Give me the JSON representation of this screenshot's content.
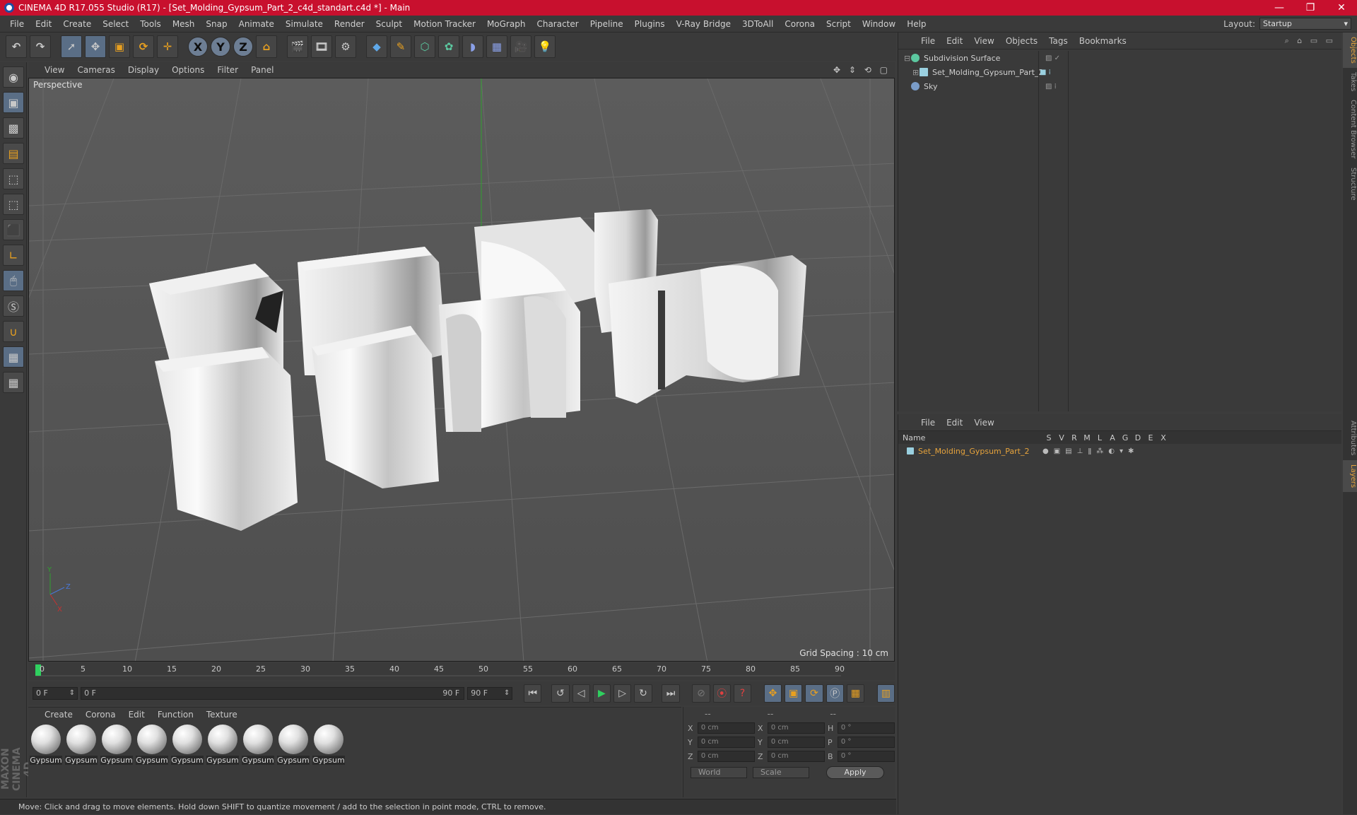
{
  "app": {
    "title": "CINEMA 4D R17.055 Studio (R17) - [Set_Molding_Gypsum_Part_2_c4d_standart.c4d *] - Main",
    "window_controls": [
      "—",
      "❐",
      "✕"
    ]
  },
  "menubar": {
    "items": [
      "File",
      "Edit",
      "Create",
      "Select",
      "Tools",
      "Mesh",
      "Snap",
      "Animate",
      "Simulate",
      "Render",
      "Sculpt",
      "Motion Tracker",
      "MoGraph",
      "Character",
      "Pipeline",
      "Plugins",
      "V-Ray Bridge",
      "3DToAll",
      "Corona",
      "Script",
      "Window",
      "Help"
    ],
    "layout_label": "Layout:",
    "layout_value": "Startup"
  },
  "toolbar": {
    "axis_x": "X",
    "axis_y": "Y",
    "axis_z": "Z"
  },
  "viewport": {
    "menu": [
      "View",
      "Cameras",
      "Display",
      "Options",
      "Filter",
      "Panel"
    ],
    "label": "Perspective",
    "grid_spacing": "Grid Spacing : 10 cm",
    "nav_icons": "✥ ⇕ ⟲ ▢"
  },
  "timeline": {
    "ticks": [
      "0",
      "5",
      "10",
      "15",
      "20",
      "25",
      "30",
      "35",
      "40",
      "45",
      "50",
      "55",
      "60",
      "65",
      "70",
      "75",
      "80",
      "85",
      "90"
    ],
    "current_frame": "0 F"
  },
  "transport": {
    "start": "0 F",
    "range_start": "0 F",
    "range_end": "90 F",
    "end": "90 F"
  },
  "materials": {
    "menu": [
      "Create",
      "Corona",
      "Edit",
      "Function",
      "Texture"
    ],
    "items": [
      "Gypsum",
      "Gypsum",
      "Gypsum",
      "Gypsum",
      "Gypsum",
      "Gypsum",
      "Gypsum",
      "Gypsum",
      "Gypsum"
    ]
  },
  "coords": {
    "headers": [
      "--",
      "--",
      "--"
    ],
    "rows": [
      {
        "a": "X",
        "v1": "0 cm",
        "b": "X",
        "v2": "0 cm",
        "c": "H",
        "v3": "0 °"
      },
      {
        "a": "Y",
        "v1": "0 cm",
        "b": "Y",
        "v2": "0 cm",
        "c": "P",
        "v3": "0 °"
      },
      {
        "a": "Z",
        "v1": "0 cm",
        "b": "Z",
        "v2": "0 cm",
        "c": "B",
        "v3": "0 °"
      }
    ],
    "mode1": "World",
    "mode2": "Scale",
    "apply": "Apply"
  },
  "objects": {
    "menu": [
      "File",
      "Edit",
      "View",
      "Objects",
      "Tags",
      "Bookmarks"
    ],
    "items": [
      {
        "name": "Subdivision Surface",
        "color": "#5cc8a0",
        "indent": 0
      },
      {
        "name": "Set_Molding_Gypsum_Part_2",
        "color": "#9ad0e0",
        "indent": 1
      },
      {
        "name": "Sky",
        "color": "#7a9cc8",
        "indent": 0
      }
    ]
  },
  "layers": {
    "menu": [
      "File",
      "Edit",
      "View"
    ],
    "headers": [
      "Name",
      "S",
      "V",
      "R",
      "M",
      "L",
      "A",
      "G",
      "D",
      "E",
      "X"
    ],
    "items": [
      {
        "name": "Set_Molding_Gypsum_Part_2",
        "color": "#e6a33c"
      }
    ]
  },
  "right_tabs": [
    "Objects",
    "Takes",
    "Content Browser",
    "Structure",
    "Attributes",
    "Layers"
  ],
  "status": "Move: Click and drag to move elements. Hold down SHIFT to quantize movement / add to the selection in point mode, CTRL to remove.",
  "brand": "MAXON CINEMA 4D"
}
